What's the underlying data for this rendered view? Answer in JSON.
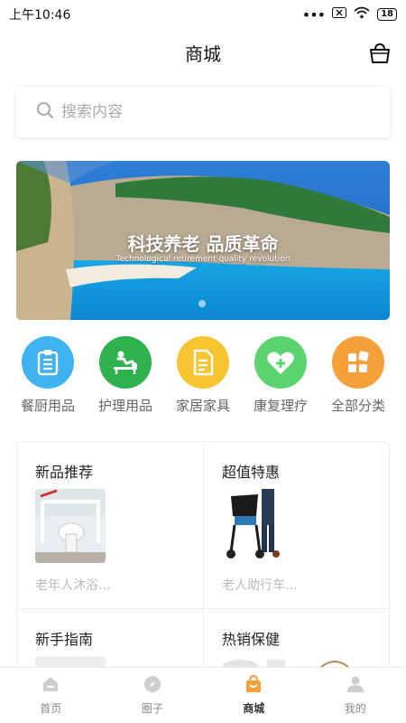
{
  "status": {
    "time": "上午10:46",
    "battery": "18"
  },
  "header": {
    "title": "商城"
  },
  "search": {
    "placeholder": "搜索内容"
  },
  "banner": {
    "title": "科技养老 品质革命",
    "subtitle": "Technological retirement quality revolution"
  },
  "categories": [
    {
      "label": "餐厨用品",
      "icon": "clipboard-icon",
      "color": "#3fb2f0"
    },
    {
      "label": "护理用品",
      "icon": "massage-icon",
      "color": "#2fb14e"
    },
    {
      "label": "家居家具",
      "icon": "document-icon",
      "color": "#f7c532"
    },
    {
      "label": "康复理疗",
      "icon": "heart-plus-icon",
      "color": "#5bd46f"
    },
    {
      "label": "全部分类",
      "icon": "grid-icon",
      "color": "#f6a03a"
    }
  ],
  "sections": [
    {
      "title": "新品推荐",
      "product": "老年人沐浴..."
    },
    {
      "title": "超值特惠",
      "product": "老人助行车..."
    },
    {
      "title": "新手指南",
      "product": ""
    },
    {
      "title": "热销保健",
      "product": ""
    }
  ],
  "tabs": [
    {
      "label": "首页",
      "icon": "home-icon"
    },
    {
      "label": "圈子",
      "icon": "compass-icon"
    },
    {
      "label": "商城",
      "icon": "shop-icon",
      "active": true
    },
    {
      "label": "我的",
      "icon": "user-icon"
    }
  ],
  "colors": {
    "accent": "#f6a03a",
    "muted": "#cccccc"
  }
}
